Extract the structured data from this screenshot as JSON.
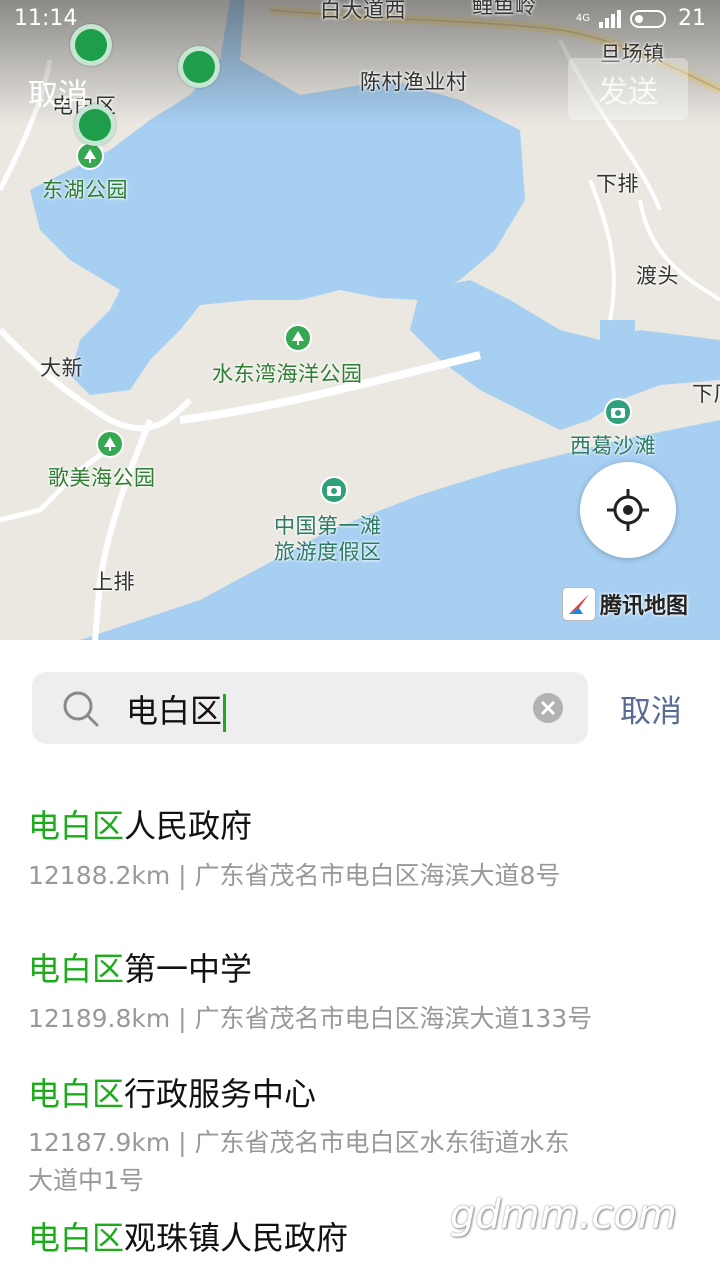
{
  "status_bar": {
    "time": "11:14",
    "network": "4G",
    "battery": "21"
  },
  "map": {
    "top_cancel": "取消",
    "send_label": "发送",
    "brand": "腾讯地图",
    "labels": [
      {
        "id": "road-top",
        "text": "白大道西"
      },
      {
        "id": "town-top",
        "text": "鲤鱼岭"
      },
      {
        "id": "danchang",
        "text": "旦场镇"
      },
      {
        "id": "chencun",
        "text": "陈村渔业村"
      },
      {
        "id": "dianbaiqu",
        "text": "电白区"
      },
      {
        "id": "xiapai",
        "text": "下排"
      },
      {
        "id": "dutou",
        "text": "渡头"
      },
      {
        "id": "daxin",
        "text": "大新"
      },
      {
        "id": "xiapai2",
        "text": "下厂"
      },
      {
        "id": "shangpai",
        "text": "上排"
      }
    ],
    "pois": [
      {
        "id": "donghu",
        "text": "东湖公园"
      },
      {
        "id": "shuidong",
        "text": "水东湾海洋公园"
      },
      {
        "id": "gemei",
        "text": "歌美海公园"
      },
      {
        "id": "xige",
        "text": "西葛沙滩"
      },
      {
        "id": "zhongguo1",
        "text": "中国第一滩"
      },
      {
        "id": "zhongguo2",
        "text": "旅游度假区"
      }
    ]
  },
  "search": {
    "query": "电白区",
    "cancel": "取消"
  },
  "results": [
    {
      "highlight": "电白区",
      "rest": "人民政府",
      "line1": "12188.2km | 广东省茂名市电白区海滨大道8号",
      "line2": ""
    },
    {
      "highlight": "电白区",
      "rest": "第一中学",
      "line1": "12189.8km | 广东省茂名市电白区海滨大道133号",
      "line2": ""
    },
    {
      "highlight": "电白区",
      "rest": "行政服务中心",
      "line1": "12187.9km | 广东省茂名市电白区水东街道水东",
      "line2": "大道中1号"
    },
    {
      "highlight": "电白区",
      "rest": "观珠镇人民政府",
      "line1": "",
      "line2": ""
    }
  ],
  "watermark": "gdmm.com",
  "colors": {
    "water": "#a6cff2",
    "land": "#ebe8e2",
    "accent": "#1aad19",
    "link": "#576b95"
  }
}
